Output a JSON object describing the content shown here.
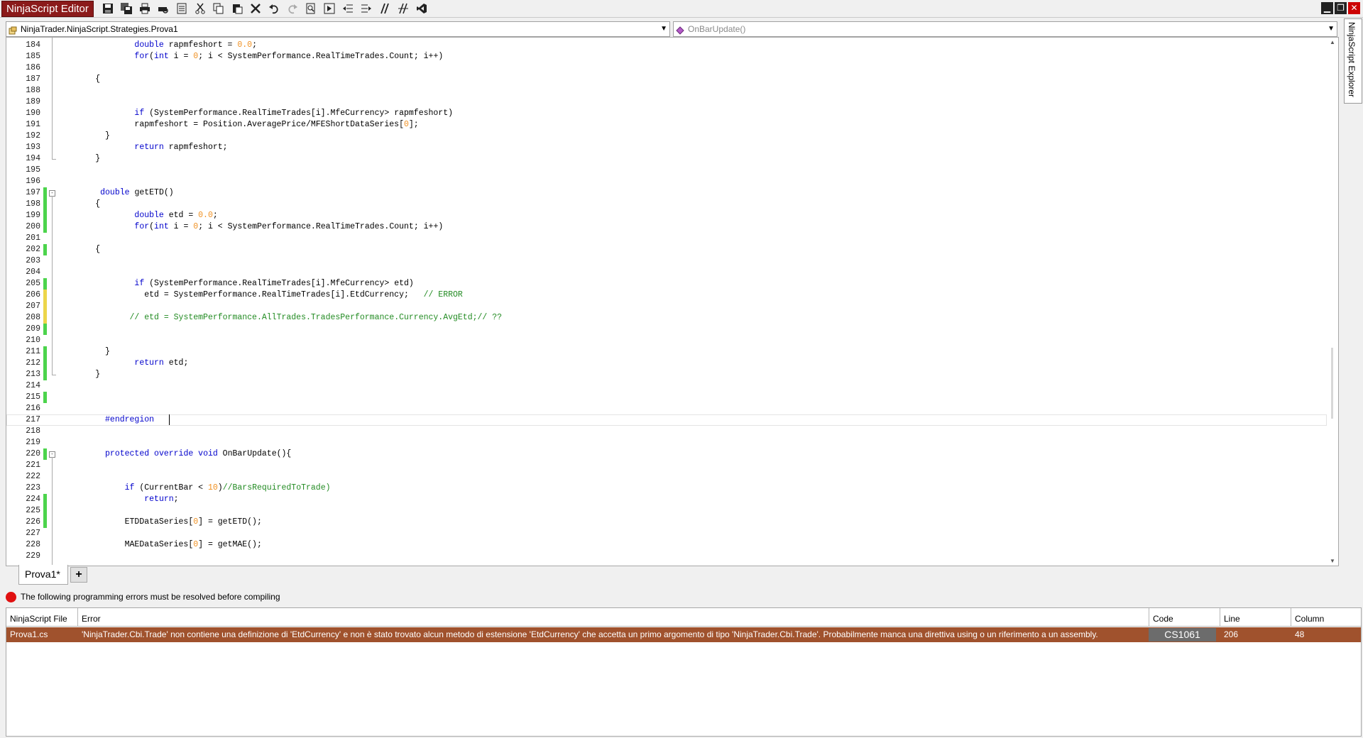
{
  "app": {
    "title": "NinjaScript Editor"
  },
  "toolbar": {
    "buttons": [
      "save-icon",
      "save-all-icon",
      "print-icon",
      "print-preview-icon",
      "templates-icon",
      "cut-icon",
      "copy-icon",
      "paste-icon",
      "delete-icon",
      "undo-icon",
      "redo-icon",
      "find-icon",
      "compile-icon",
      "outdent-icon",
      "indent-icon",
      "comment-icon",
      "uncomment-icon",
      "visual-studio-icon"
    ]
  },
  "window": {
    "controls": [
      "minimize-icon",
      "restore-icon",
      "close-icon"
    ]
  },
  "combos": {
    "class_selector": "NinjaTrader.NinjaScript.Strategies.Prova1",
    "method_selector": "OnBarUpdate()"
  },
  "side_panel": {
    "label": "NinjaScript Explorer"
  },
  "editor": {
    "lines": [
      {
        "n": "184",
        "html": "                <span class=\"kw\">double</span> rapmfeshort = <span class=\"num-lit\">0.0</span>;",
        "chg": ""
      },
      {
        "n": "185",
        "html": "                <span class=\"kw\">for</span>(<span class=\"kw\">int</span> i = <span class=\"num-lit\">0</span>; i &lt; SystemPerformance.RealTimeTrades.Count; i++)",
        "chg": ""
      },
      {
        "n": "186",
        "html": "",
        "chg": ""
      },
      {
        "n": "187",
        "html": "        {",
        "chg": ""
      },
      {
        "n": "188",
        "html": "",
        "chg": ""
      },
      {
        "n": "189",
        "html": "",
        "chg": ""
      },
      {
        "n": "190",
        "html": "                <span class=\"kw\">if</span> (SystemPerformance.RealTimeTrades[i].MfeCurrency&gt; rapmfeshort)",
        "chg": ""
      },
      {
        "n": "191",
        "html": "                rapmfeshort = Position.AveragePrice/MFEShortDataSeries[<span class=\"num-lit\">0</span>];",
        "chg": ""
      },
      {
        "n": "192",
        "html": "          }",
        "chg": ""
      },
      {
        "n": "193",
        "html": "                <span class=\"kw\">return</span> rapmfeshort;",
        "chg": ""
      },
      {
        "n": "194",
        "html": "        }",
        "chg": ""
      },
      {
        "n": "195",
        "html": "",
        "chg": ""
      },
      {
        "n": "196",
        "html": "",
        "chg": ""
      },
      {
        "n": "197",
        "html": "         <span class=\"kw\">double</span> getETD()",
        "chg": "saved",
        "fold": "-"
      },
      {
        "n": "198",
        "html": "        {",
        "chg": "saved"
      },
      {
        "n": "199",
        "html": "                <span class=\"kw\">double</span> etd = <span class=\"num-lit\">0.0</span>;",
        "chg": "saved"
      },
      {
        "n": "200",
        "html": "                <span class=\"kw\">for</span>(<span class=\"kw\">int</span> i = <span class=\"num-lit\">0</span>; i &lt; SystemPerformance.RealTimeTrades.Count; i++)",
        "chg": "saved"
      },
      {
        "n": "201",
        "html": "",
        "chg": ""
      },
      {
        "n": "202",
        "html": "        {",
        "chg": "saved"
      },
      {
        "n": "203",
        "html": "",
        "chg": ""
      },
      {
        "n": "204",
        "html": "",
        "chg": ""
      },
      {
        "n": "205",
        "html": "                <span class=\"kw\">if</span> (SystemPerformance.RealTimeTrades[i].MfeCurrency&gt; etd)",
        "chg": "saved"
      },
      {
        "n": "206",
        "html": "                  etd = SystemPerformance.RealTimeTrades[i].EtdCurrency;   <span class=\"cm\">// ERROR</span>",
        "chg": "unsaved"
      },
      {
        "n": "207",
        "html": "",
        "chg": "unsaved"
      },
      {
        "n": "208",
        "html": "               <span class=\"cm\">// etd = SystemPerformance.AllTrades.TradesPerformance.Currency.AvgEtd;// ??</span>",
        "chg": "unsaved"
      },
      {
        "n": "209",
        "html": "",
        "chg": "saved"
      },
      {
        "n": "210",
        "html": "",
        "chg": ""
      },
      {
        "n": "211",
        "html": "          }",
        "chg": "saved"
      },
      {
        "n": "212",
        "html": "                <span class=\"kw\">return</span> etd;",
        "chg": "saved"
      },
      {
        "n": "213",
        "html": "        }",
        "chg": "saved"
      },
      {
        "n": "214",
        "html": "",
        "chg": ""
      },
      {
        "n": "215",
        "html": "",
        "chg": "saved"
      },
      {
        "n": "216",
        "html": "",
        "chg": ""
      },
      {
        "n": "217",
        "html": "          <span class=\"kw\">#endregion</span>",
        "chg": "",
        "current": true
      },
      {
        "n": "218",
        "html": "",
        "chg": ""
      },
      {
        "n": "219",
        "html": "",
        "chg": ""
      },
      {
        "n": "220",
        "html": "          <span class=\"kw\">protected</span> <span class=\"kw\">override</span> <span class=\"kw\">void</span> OnBarUpdate(){",
        "chg": "saved",
        "fold": "-"
      },
      {
        "n": "221",
        "html": "",
        "chg": ""
      },
      {
        "n": "222",
        "html": "",
        "chg": ""
      },
      {
        "n": "223",
        "html": "              <span class=\"kw\">if</span> (CurrentBar &lt; <span class=\"num-lit\">10</span>)<span class=\"cm\">//BarsRequiredToTrade)</span>",
        "chg": ""
      },
      {
        "n": "224",
        "html": "                  <span class=\"kw\">return</span>;",
        "chg": "saved"
      },
      {
        "n": "225",
        "html": "",
        "chg": "saved"
      },
      {
        "n": "226",
        "html": "              ETDDataSeries[<span class=\"num-lit\">0</span>] = getETD();",
        "chg": "saved"
      },
      {
        "n": "227",
        "html": "",
        "chg": ""
      },
      {
        "n": "228",
        "html": "              MAEDataSeries[<span class=\"num-lit\">0</span>] = getMAE();",
        "chg": ""
      },
      {
        "n": "229",
        "html": "",
        "chg": ""
      }
    ]
  },
  "file_tabs": {
    "active": "Prova1*",
    "add_label": "+"
  },
  "errors": {
    "message": "The following programming errors must be resolved before compiling",
    "columns": [
      "NinjaScript File",
      "Error",
      "Code",
      "Line",
      "Column"
    ],
    "rows": [
      {
        "file": "Prova1.cs",
        "error": "'NinjaTrader.Cbi.Trade' non contiene una definizione di 'EtdCurrency' e non è stato trovato alcun metodo di estensione 'EtdCurrency' che accetta un primo argomento di tipo 'NinjaTrader.Cbi.Trade'. Probabilmente manca una direttiva using o un riferimento a un assembly.",
        "code": "CS1061",
        "line": "206",
        "column": "48"
      }
    ]
  }
}
